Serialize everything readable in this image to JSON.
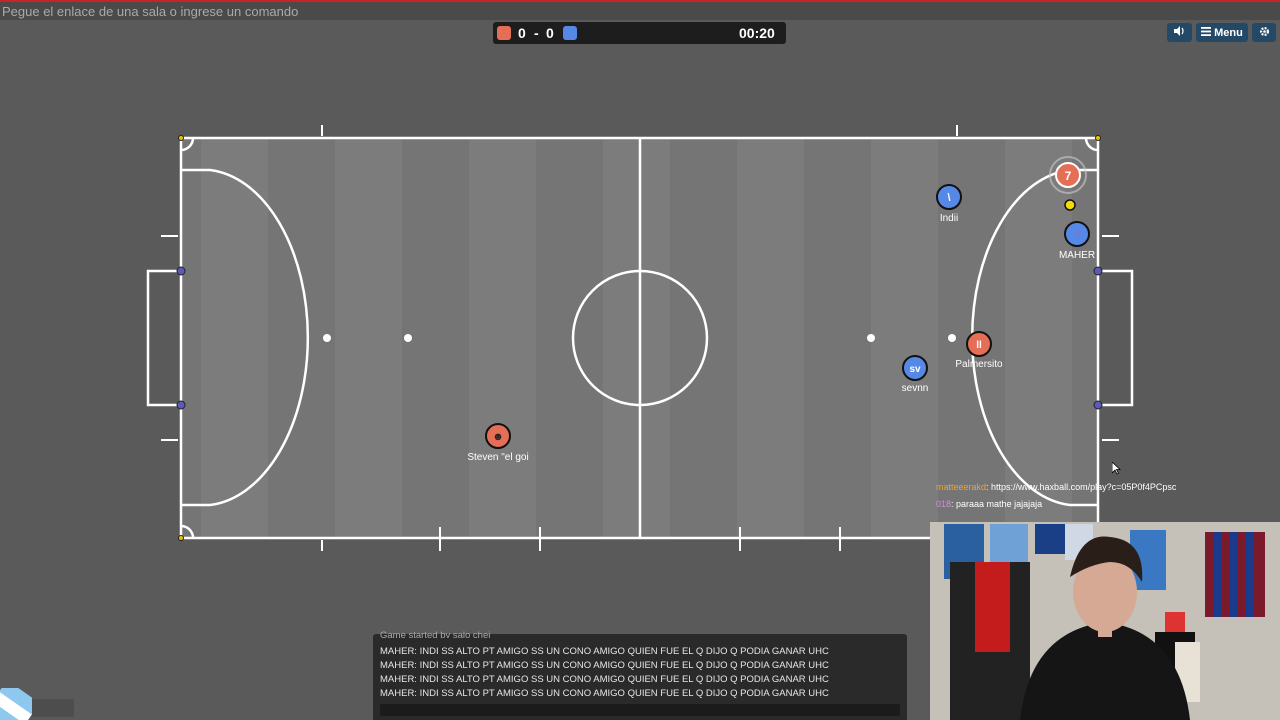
{
  "top": {
    "input_placeholder": "Pegue el enlace de una sala o ingrese un comando"
  },
  "scoreboard": {
    "red_score": "0",
    "separator": "-",
    "blue_score": "0",
    "time": "00:20",
    "red_color": "#e56e56",
    "blue_color": "#5689e5"
  },
  "buttons": {
    "sound_icon": "speaker-icon",
    "menu_label": "Menu",
    "menu_icon": "hamburger-icon",
    "settings_icon": "gear-icon"
  },
  "players": [
    {
      "name": "Indii",
      "team": "blue",
      "avatar": "\\"
    },
    {
      "name": "MAHER",
      "team": "blue",
      "avatar": "☃"
    },
    {
      "name": "sevnn",
      "team": "blue",
      "avatar": "sv"
    },
    {
      "name": "Palmersito",
      "team": "red",
      "avatar": "ll"
    },
    {
      "name": "Steven \"el goi",
      "team": "red",
      "avatar": "☻"
    },
    {
      "name": "",
      "team": "red",
      "avatar": "7"
    }
  ],
  "chat_overlay": [
    {
      "user": "matteeerakd",
      "message": ": https://www.haxball.com/play?c=05P0f4PCpsc",
      "user_color": "#f0a030"
    },
    {
      "user": "018",
      "message": ": paraaa mathe jajajaja",
      "user_color": "#d58ae0"
    }
  ],
  "chat": {
    "partial_line": "Game started by salo chej",
    "lines": [
      "MAHER: INDI SS ALTO PT AMIGO SS UN CONO AMIGO QUIEN FUE EL Q DIJO Q PODIA GANAR UHC",
      "MAHER: INDI SS ALTO PT AMIGO SS UN CONO AMIGO QUIEN FUE EL Q DIJO Q PODIA GANAR UHC",
      "MAHER: INDI SS ALTO PT AMIGO SS UN CONO AMIGO QUIEN FUE EL Q DIJO Q PODIA GANAR UHC",
      "MAHER: INDI SS ALTO PT AMIGO SS UN CONO AMIGO QUIEN FUE EL Q DIJO Q PODIA GANAR UHC"
    ]
  },
  "colors": {
    "field": "#777777",
    "lines": "#ffffff",
    "ball": "#f5d90a",
    "post_blue": "#5a5ab8"
  }
}
